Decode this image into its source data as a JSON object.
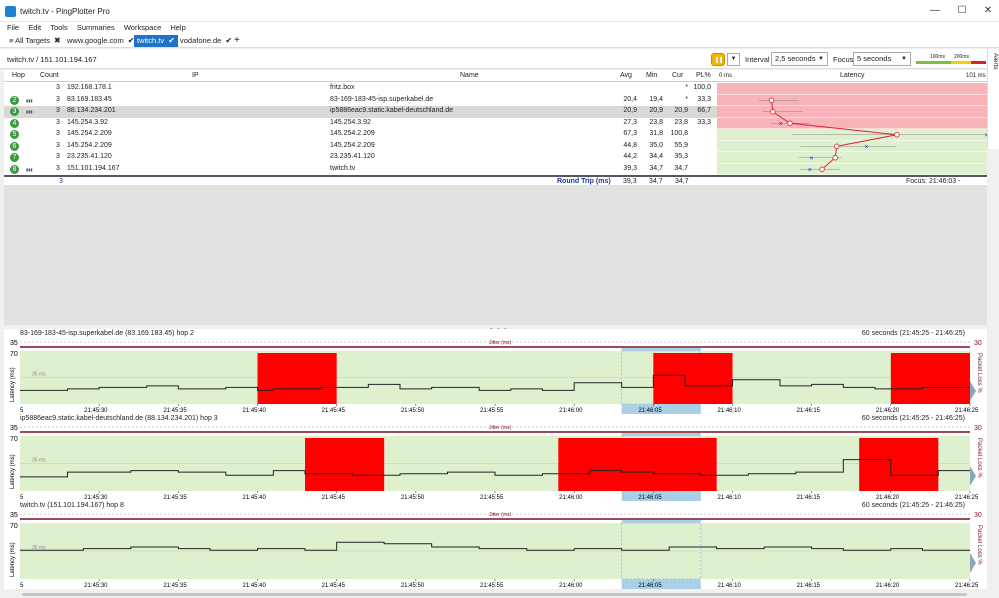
{
  "window": {
    "title": "twitch.tv - PingPlotter Pro",
    "min": "—",
    "max": "☐",
    "close": "✕"
  },
  "menu": [
    "File",
    "Edit",
    "Tools",
    "Summaries",
    "Workspace",
    "Help"
  ],
  "tabs": [
    {
      "label": "All Targets",
      "mark": "✖",
      "active": false
    },
    {
      "label": "www.google.com",
      "mark": "✔",
      "active": false
    },
    {
      "label": "twitch.tv",
      "mark": "✔",
      "active": true
    },
    {
      "label": "vodafone.de",
      "mark": "✔",
      "active": false
    }
  ],
  "add_tab": "+",
  "toolbar": {
    "breadcrumb": "twitch.tv / 151.101.194.167",
    "interval_label": "Interval",
    "interval_value": "2,5 seconds",
    "focus_label": "Focus",
    "focus_value": "5 seconds",
    "legend_100": "100ms",
    "legend_200": "200ms",
    "alerts": "Alerts"
  },
  "grid": {
    "headers": {
      "hop": "Hop",
      "count": "Count",
      "ip": "IP",
      "name": "Name",
      "avg": "Avg",
      "min": "Min",
      "cur": "Cur",
      "pl": "PL%",
      "latency": "Latency",
      "lat_min": "0 ms",
      "lat_max": "101 ms"
    },
    "rows": [
      {
        "hop": "",
        "count": "3",
        "ip": "192.168.178.1",
        "name": "fritz.box",
        "avg": "",
        "min": "",
        "cur": "*",
        "pl": "100,0",
        "loss": true
      },
      {
        "hop": "2",
        "count": "3",
        "ip": "83.169.183.45",
        "name": "83-169-183-45-isp.superkabel.de",
        "avg": "20,4",
        "min": "19,4",
        "cur": "*",
        "pl": "33,3",
        "loss": true
      },
      {
        "hop": "3",
        "count": "3",
        "ip": "88.134.234.201",
        "name": "ip5886eac9.static.kabel-deutschland.de",
        "avg": "20,9",
        "min": "20,9",
        "cur": "20,9",
        "pl": "66,7",
        "loss": true
      },
      {
        "hop": "4",
        "count": "3",
        "ip": "145.254.3.92",
        "name": "145.254.3.92",
        "avg": "27,3",
        "min": "23,8",
        "cur": "23,8",
        "pl": "33,3",
        "loss": true
      },
      {
        "hop": "5",
        "count": "3",
        "ip": "145.254.2.209",
        "name": "145.254.2.209",
        "avg": "67,3",
        "min": "31,8",
        "cur": "100,8",
        "pl": "",
        "loss": false
      },
      {
        "hop": "6",
        "count": "3",
        "ip": "145.254.2.209",
        "name": "145.254.2.209",
        "avg": "44,8",
        "min": "35,0",
        "cur": "55,9",
        "pl": "",
        "loss": false
      },
      {
        "hop": "7",
        "count": "3",
        "ip": "23.235.41.120",
        "name": "23.235.41.120",
        "avg": "44,2",
        "min": "34,4",
        "cur": "35,3",
        "pl": "",
        "loss": false
      },
      {
        "hop": "8",
        "count": "3",
        "ip": "151.101.194.167",
        "name": "twitch.tv",
        "avg": "39,3",
        "min": "34,7",
        "cur": "34,7",
        "pl": "",
        "loss": false
      }
    ],
    "summary": {
      "count": "3",
      "label": "Round Trip (ms)",
      "avg": "39,3",
      "min": "34,7",
      "cur": "34,7",
      "focus": "Focus: 21:46:03 - 21:46:08"
    }
  },
  "splitter": "• • •",
  "panels": [
    {
      "title": "83-169-183-45-isp.superkabel.de (83.169.183.45) hop 2",
      "range": "60 seconds (21:45:25 - 21:46:25)"
    },
    {
      "title": "ip5886eac9.static.kabel-deutschland.de (88.134.234.201) hop 3",
      "range": "60 seconds (21:45:25 - 21:46:25)"
    },
    {
      "title": "twitch.tv (151.101.194.167) hop 8",
      "range": "60 seconds (21:45:25 - 21:46:25)"
    }
  ],
  "chart_common": {
    "y_max_label": "35",
    "y_lat_label": "70",
    "ms_label": "35 ms",
    "jitter_label": "Jitter (ms)",
    "latency_axis": "Latency (ms)",
    "loss_axis": "Packet Loss %",
    "loss_max": "30",
    "x_ticks": [
      "21:45:30",
      "21:45:35",
      "21:45:40",
      "21:45:45",
      "21:45:50",
      "21:45:55",
      "21:46:00",
      "21:46:05",
      "21:46:10",
      "21:46:15",
      "21:46:20",
      "21:46:25"
    ],
    "first_tick": "5"
  },
  "chart_data": [
    {
      "type": "line",
      "title": "83-169-183-45-isp.superkabel.de (83.169.183.45) hop 2",
      "x_range": [
        "21:45:25",
        "21:46:25"
      ],
      "ylim": [
        0,
        70
      ],
      "x_ticks": [
        "21:45:30",
        "21:45:35",
        "21:45:40",
        "21:45:45",
        "21:45:50",
        "21:45:55",
        "21:46:00",
        "21:46:05",
        "21:46:10",
        "21:46:15",
        "21:46:20",
        "21:46:25"
      ],
      "latency_ms": [
        18,
        18,
        18,
        20,
        20,
        22,
        22,
        22,
        24,
        24,
        20,
        20,
        20,
        22,
        22,
        18,
        20,
        20,
        20,
        22,
        22,
        22,
        26,
        26,
        20,
        20,
        22,
        22,
        22,
        18,
        18,
        20,
        20,
        18,
        18,
        28,
        28,
        28,
        22,
        22,
        38,
        38,
        24,
        24,
        24,
        32,
        32,
        32,
        24,
        24,
        26,
        26,
        22,
        22,
        20,
        20,
        20,
        22,
        22,
        22
      ],
      "loss_periods": [
        [
          "21:45:40",
          "21:45:45"
        ],
        [
          "21:46:05",
          "21:46:10"
        ],
        [
          "21:46:20",
          "21:46:25"
        ]
      ]
    },
    {
      "type": "line",
      "title": "ip5886eac9.static.kabel-deutschland.de (88.134.234.201) hop 3",
      "x_range": [
        "21:45:25",
        "21:46:25"
      ],
      "ylim": [
        0,
        70
      ],
      "x_ticks": [
        "21:45:30",
        "21:45:35",
        "21:45:40",
        "21:45:45",
        "21:45:50",
        "21:45:55",
        "21:46:00",
        "21:46:05",
        "21:46:10",
        "21:46:15",
        "21:46:20",
        "21:46:25"
      ],
      "latency_ms": [
        18,
        18,
        18,
        24,
        24,
        24,
        24,
        26,
        26,
        26,
        24,
        24,
        24,
        20,
        20,
        20,
        26,
        26,
        22,
        22,
        22,
        20,
        20,
        20,
        22,
        22,
        22,
        24,
        24,
        24,
        20,
        20,
        20,
        22,
        22,
        22,
        26,
        26,
        24,
        24,
        22,
        22,
        22,
        20,
        20,
        20,
        22,
        22,
        22,
        24,
        24,
        24,
        40,
        40,
        40,
        20,
        20,
        20,
        26,
        26
      ],
      "loss_periods": [
        [
          "21:45:43",
          "21:45:48"
        ],
        [
          "21:45:59",
          "21:46:09"
        ],
        [
          "21:46:18",
          "21:46:23"
        ]
      ]
    },
    {
      "type": "line",
      "title": "twitch.tv (151.101.194.167) hop 8",
      "x_range": [
        "21:45:25",
        "21:46:25"
      ],
      "ylim": [
        0,
        70
      ],
      "x_ticks": [
        "21:45:30",
        "21:45:35",
        "21:45:40",
        "21:45:45",
        "21:45:50",
        "21:45:55",
        "21:46:00",
        "21:46:05",
        "21:46:10",
        "21:46:15",
        "21:46:20",
        "21:46:25"
      ],
      "latency_ms": [
        36,
        36,
        36,
        36,
        38,
        38,
        38,
        40,
        40,
        40,
        38,
        38,
        36,
        36,
        36,
        38,
        38,
        38,
        36,
        36,
        46,
        46,
        46,
        44,
        44,
        44,
        40,
        40,
        40,
        38,
        38,
        38,
        36,
        36,
        36,
        38,
        38,
        38,
        36,
        36,
        36,
        40,
        40,
        40,
        38,
        38,
        38,
        40,
        40,
        40,
        38,
        38,
        36,
        36,
        36,
        38,
        38,
        36,
        36,
        36
      ],
      "loss_periods": []
    }
  ],
  "colors": {
    "accent": "#1e73c8",
    "loss": "#ff0000",
    "row_loss": "#f7b3b8",
    "row_ok": "#dff0cf",
    "line": "#222222",
    "hop_green": "#3c9a3c"
  }
}
